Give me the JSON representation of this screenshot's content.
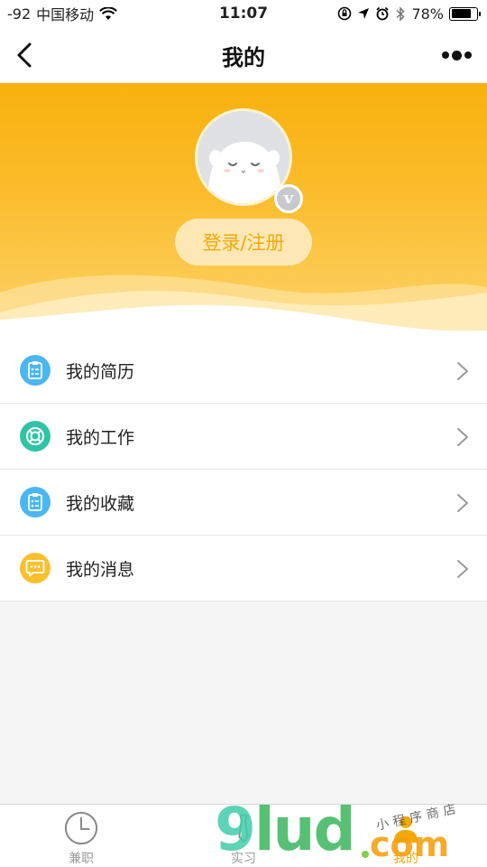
{
  "status_bar": {
    "signal": "-92",
    "carrier": "中国移动",
    "time": "11:07",
    "battery_percent": "78%",
    "battery_level": 0.78
  },
  "nav": {
    "title": "我的"
  },
  "profile": {
    "vip_letter": "v",
    "login_label": "登录/注册"
  },
  "menu": [
    {
      "label": "我的简历",
      "icon": "resume-icon",
      "color": "#4ab7f0"
    },
    {
      "label": "我的工作",
      "icon": "lifebuoy-icon",
      "color": "#2fc4a4"
    },
    {
      "label": "我的收藏",
      "icon": "clipboard-icon",
      "color": "#4ab7f0"
    },
    {
      "label": "我的消息",
      "icon": "message-icon",
      "color": "#fbc02d"
    }
  ],
  "tabs": [
    {
      "label": "兼职",
      "icon": "clock-icon"
    },
    {
      "label": "实习",
      "icon": "tie-icon"
    },
    {
      "label": "我的",
      "icon": "user-icon",
      "active": true
    }
  ],
  "watermark": {
    "brand_9": "9",
    "brand_lud": "lud",
    "brand_com": "com",
    "tagline": "小程序商店"
  },
  "colors": {
    "accent": "#f8b10d",
    "accent_text": "#f3a90a",
    "login_bg": "#fde8b5"
  }
}
